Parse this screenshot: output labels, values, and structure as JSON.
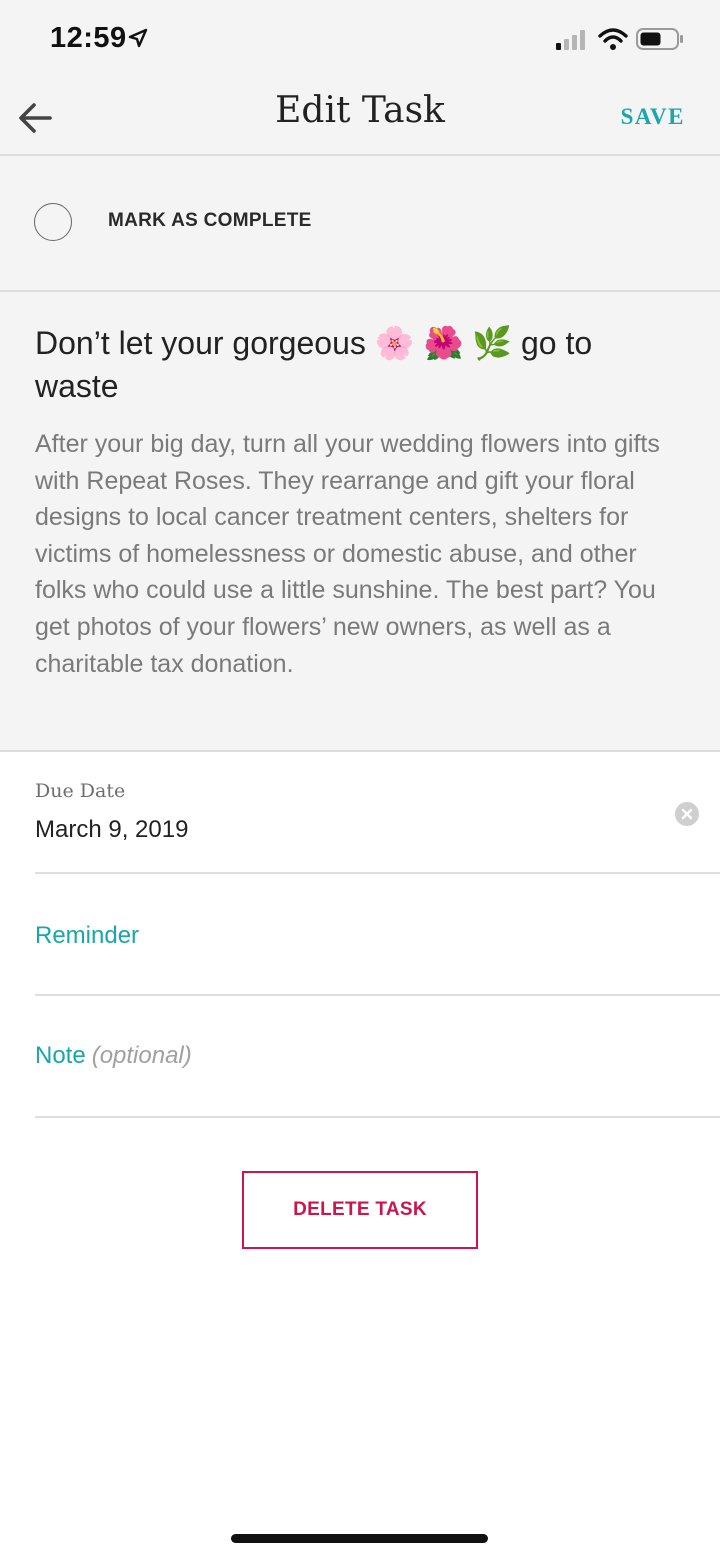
{
  "status_bar": {
    "time": "12:59",
    "icons": [
      "location-arrow-icon",
      "signal-icon",
      "wifi-icon",
      "battery-icon"
    ]
  },
  "header": {
    "title": "Edit Task",
    "save_label": "SAVE",
    "back_icon": "back-arrow-icon"
  },
  "complete": {
    "label": "MARK AS COMPLETE"
  },
  "task": {
    "title": "Don’t let your gorgeous 🌸 🌺 🌿  go to waste",
    "description": "After your big day, turn all your wedding flowers into gifts with Repeat Roses. They rearrange and gift your floral designs to local cancer treatment centers, shelters for victims of homelessness or domestic abuse, and other folks who could use a little sunshine. The best part? You get photos of your flowers’ new owners, as well as a charitable tax donation."
  },
  "due_date": {
    "label": "Due Date",
    "value": "March 9, 2019"
  },
  "reminder": {
    "label": "Reminder"
  },
  "note": {
    "label": "Note",
    "placeholder": "(optional)"
  },
  "delete_label": "DELETE TASK",
  "colors": {
    "accent": "#1aa6ab",
    "danger": "#c8174f",
    "background_gray": "#f4f4f4"
  }
}
